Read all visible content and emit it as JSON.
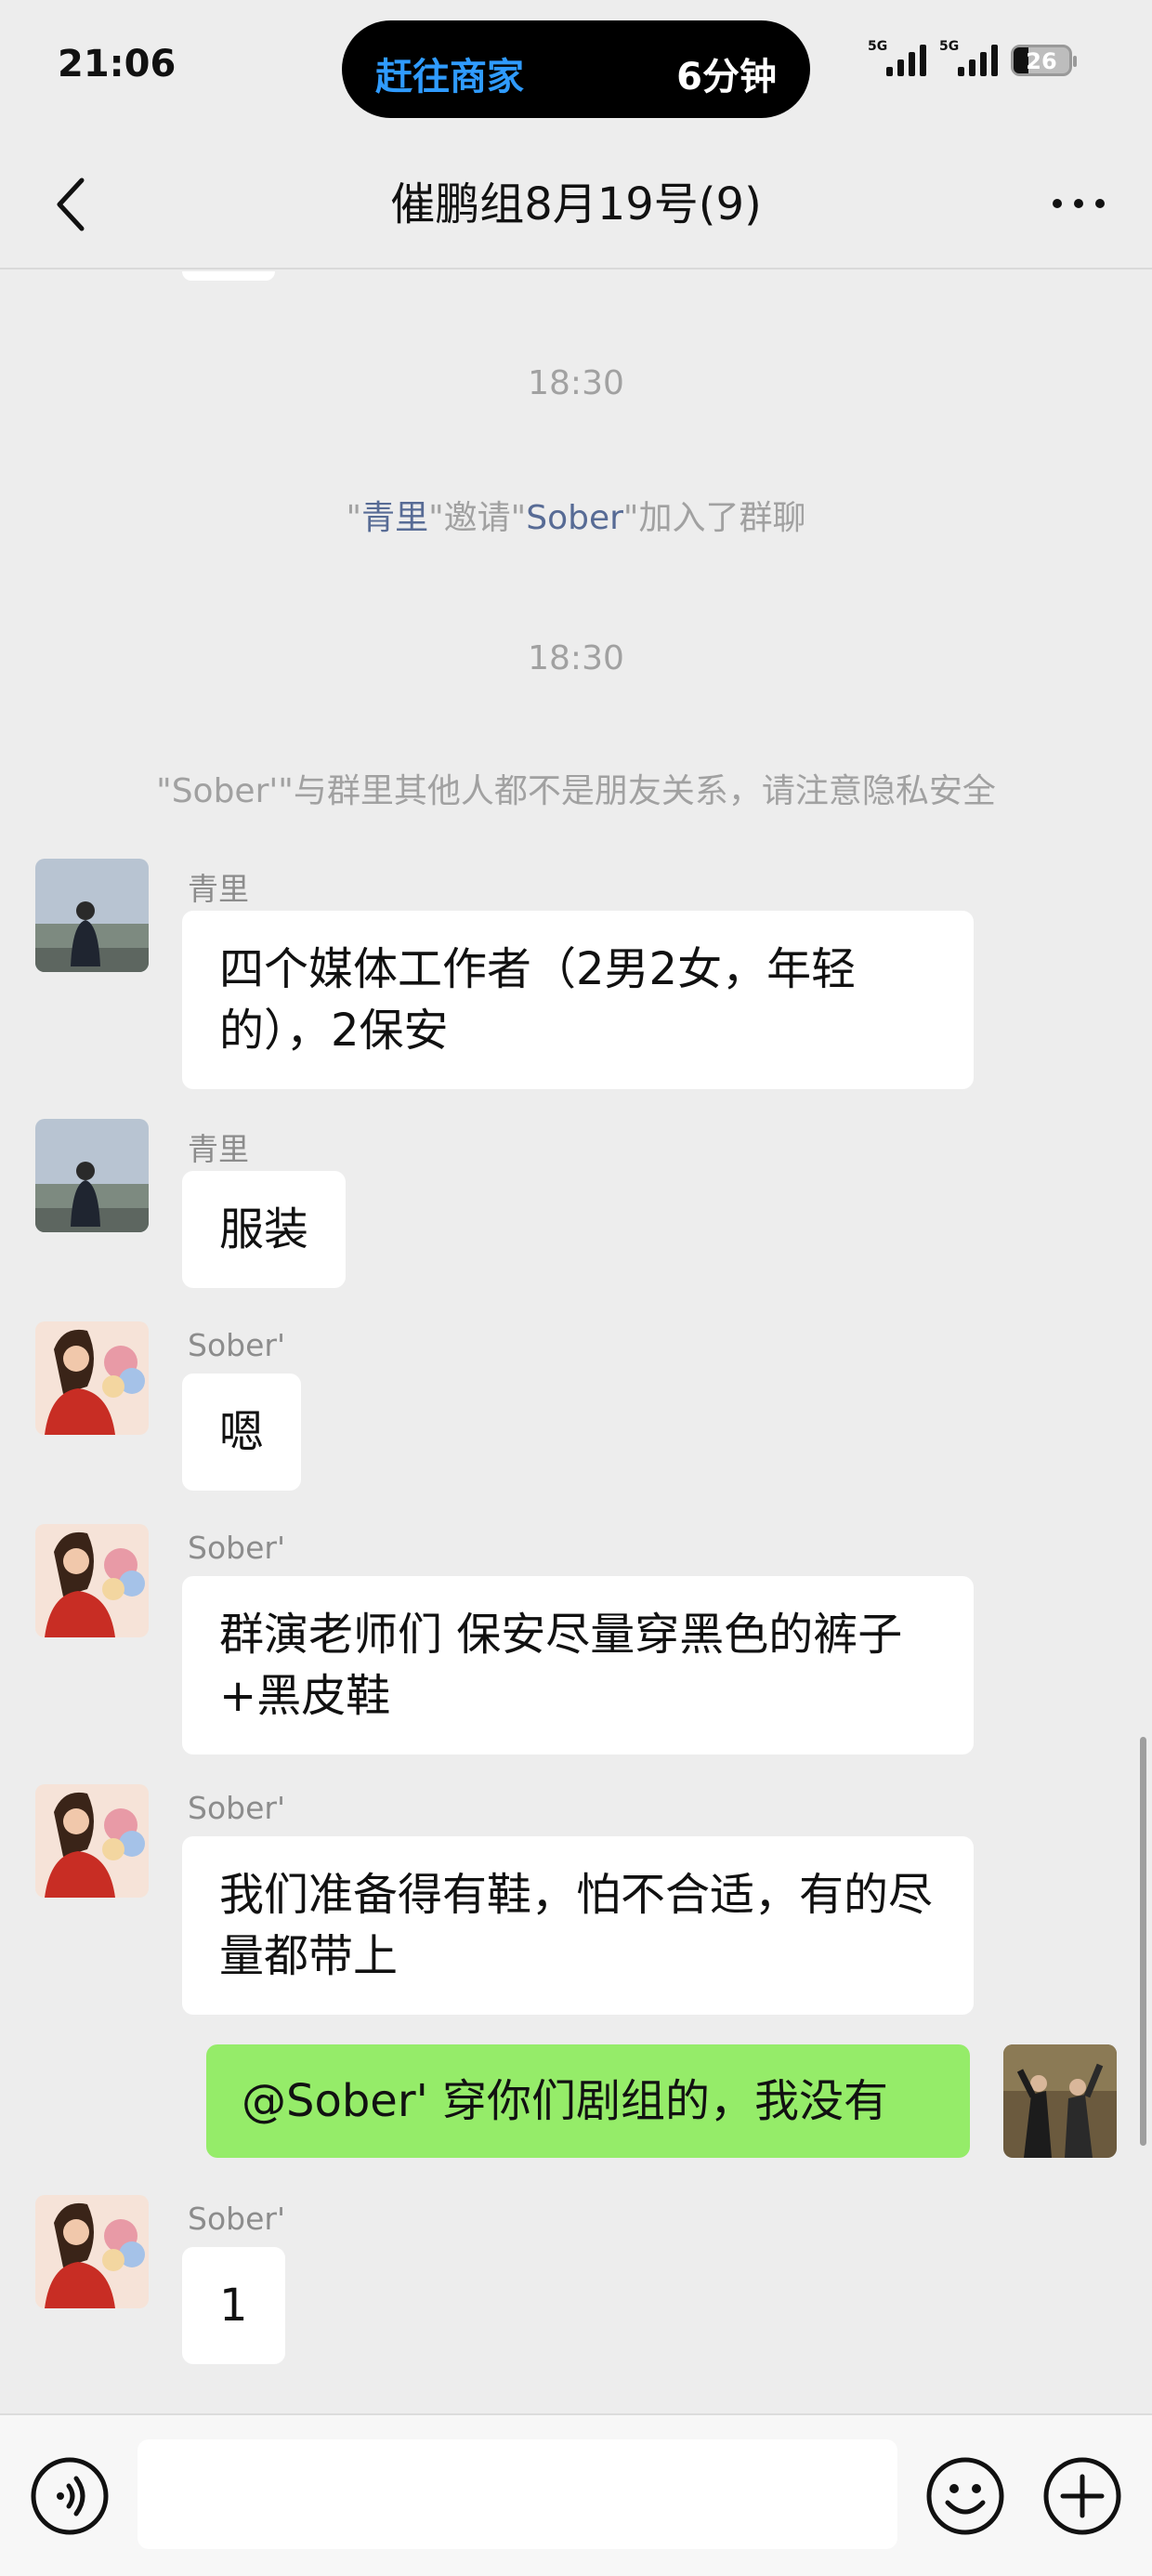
{
  "status_bar": {
    "time": "21:06",
    "island_app": "赶往商家",
    "island_eta": "6分钟",
    "signal1_tag": "5G",
    "signal2_tag": "5G",
    "battery": "26"
  },
  "nav": {
    "title": "催鹏组8月19号(9)",
    "back_icon": "chevron-left-icon",
    "more_icon": "more-dots-icon"
  },
  "messages": {
    "time1": "18:30",
    "invite": {
      "q1": "\"",
      "inviter": "青里",
      "mid": "\"邀请\"",
      "invitee": "Sober",
      "end": "\"加入了群聊"
    },
    "time2": "18:30",
    "privacy_notice": "\"Sober'\"与群里其他人都不是朋友关系，请注意隐私安全",
    "m1": {
      "sender": "青里",
      "text": "四个媒体工作者（2男2女，年轻的），2保安"
    },
    "m2": {
      "sender": "青里",
      "text": "服装"
    },
    "m3": {
      "sender": "Sober'",
      "text": "嗯"
    },
    "m4": {
      "sender": "Sober'",
      "text": "群演老师们 保安尽量穿黑色的裤子+黑皮鞋"
    },
    "m5": {
      "sender": "Sober'",
      "text": "我们准备得有鞋，怕不合适，有的尽量都带上"
    },
    "m6": {
      "text": "@Sober' 穿你们剧组的，我没有"
    },
    "m7": {
      "sender": "Sober'",
      "text": "1"
    }
  },
  "input_bar": {
    "voice_icon": "voice-icon",
    "emoji_icon": "emoji-icon",
    "plus_icon": "plus-icon",
    "input_value": ""
  },
  "colors": {
    "background": "#ededed",
    "my_bubble": "#95ec69",
    "other_bubble": "#ffffff",
    "link": "#576b95",
    "island_app": "#2f9bff"
  }
}
